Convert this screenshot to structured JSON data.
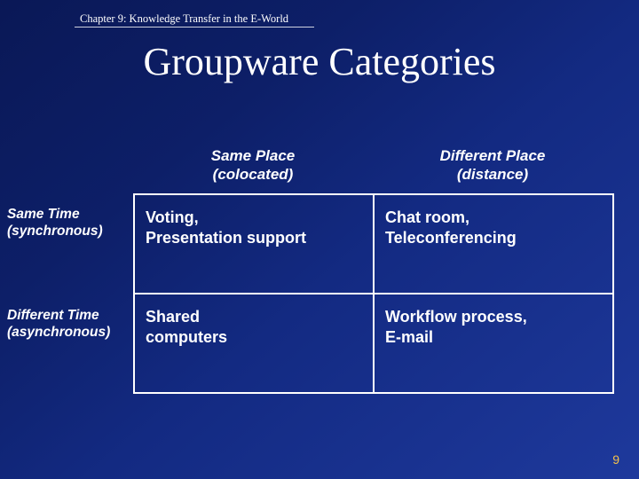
{
  "chapter": "Chapter 9: Knowledge Transfer in the E-World",
  "title": "Groupware Categories",
  "columns": {
    "c1": {
      "line1": "Same Place",
      "line2": "(colocated)"
    },
    "c2": {
      "line1": "Different Place",
      "line2": "(distance)"
    }
  },
  "rows": {
    "r1": {
      "line1": "Same Time",
      "line2": "(synchronous)"
    },
    "r2": {
      "line1": "Different Time",
      "line2": "(asynchronous)"
    }
  },
  "cells": {
    "r1c1": {
      "line1": "Voting,",
      "line2": "Presentation support"
    },
    "r1c2": {
      "line1": "Chat room,",
      "line2": "Teleconferencing"
    },
    "r2c1": {
      "line1": "Shared",
      "line2": "computers"
    },
    "r2c2": {
      "line1": "Workflow process,",
      "line2": "E-mail"
    }
  },
  "slide_number": "9",
  "chart_data": {
    "type": "table",
    "title": "Groupware Categories",
    "columns": [
      "Same Place (colocated)",
      "Different Place (distance)"
    ],
    "rows": [
      "Same Time (synchronous)",
      "Different Time (asynchronous)"
    ],
    "cells": [
      [
        "Voting, Presentation support",
        "Chat room, Teleconferencing"
      ],
      [
        "Shared computers",
        "Workflow process, E-mail"
      ]
    ]
  }
}
